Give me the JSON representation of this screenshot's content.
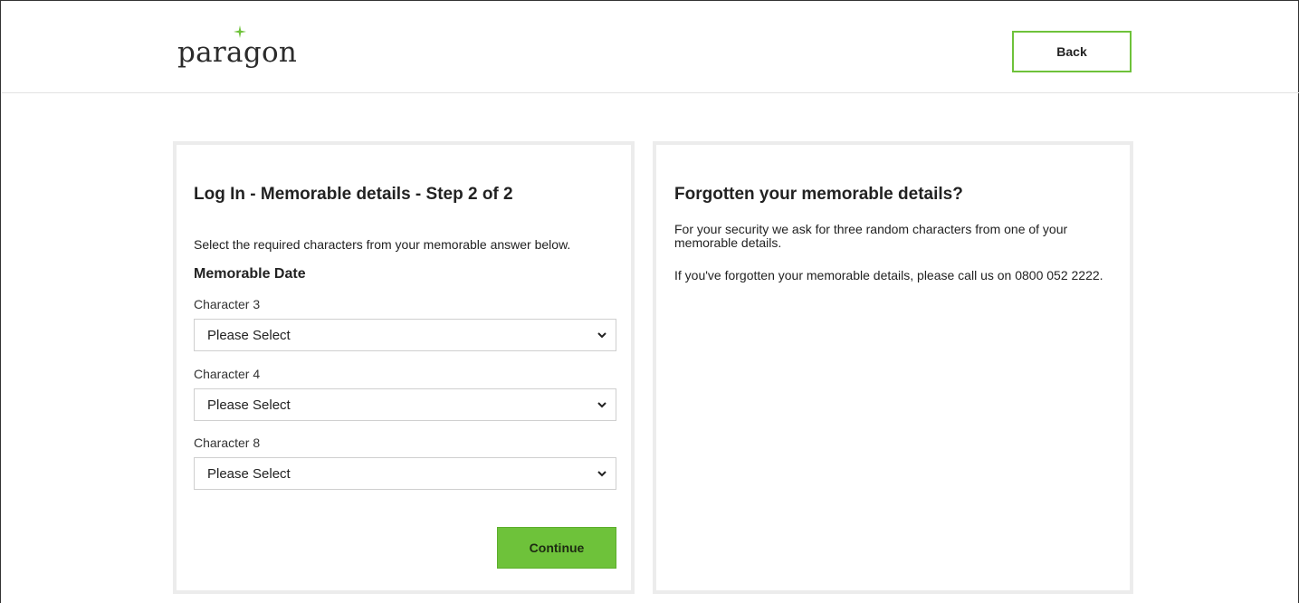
{
  "header": {
    "logo_text": "paragon",
    "back_label": "Back"
  },
  "login": {
    "title": "Log In - Memorable details - Step 2 of 2",
    "intro": "Select the required characters from your memorable answer below.",
    "group_title": "Memorable Date",
    "fields": [
      {
        "label": "Character 3",
        "value": "Please Select"
      },
      {
        "label": "Character 4",
        "value": "Please Select"
      },
      {
        "label": "Character 8",
        "value": "Please Select"
      }
    ],
    "continue_label": "Continue"
  },
  "help": {
    "title": "Forgotten your memorable details?",
    "paragraph1": "For your security we ask for three random characters from one of your memorable details.",
    "paragraph2": "If you've forgotten your memorable details, please call us on 0800 052 2222."
  },
  "colors": {
    "accent_green": "#6ec23a",
    "card_border": "#ececec"
  },
  "icons": {
    "logo_star": "four-point-star",
    "select_arrow": "chevron-down"
  }
}
